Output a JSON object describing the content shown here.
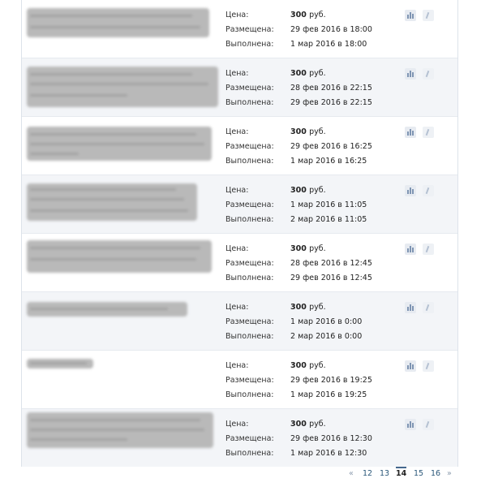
{
  "labels": {
    "price": "Цена:",
    "placed": "Размещена:",
    "completed": "Выполнена:"
  },
  "rows": [
    {
      "price_value": "300",
      "price_unit": "руб.",
      "placed": "29 фев 2016 в 18:00",
      "completed": "1 мар 2016 в 18:00"
    },
    {
      "price_value": "300",
      "price_unit": "руб.",
      "placed": "28 фев 2016 в 22:15",
      "completed": "29 фев 2016 в 22:15"
    },
    {
      "price_value": "300",
      "price_unit": "руб.",
      "placed": "29 фев 2016 в 16:25",
      "completed": "1 мар 2016 в 16:25"
    },
    {
      "price_value": "300",
      "price_unit": "руб.",
      "placed": "1 мар 2016 в 11:05",
      "completed": "2 мар 2016 в 11:05"
    },
    {
      "price_value": "300",
      "price_unit": "руб.",
      "placed": "28 фев 2016 в 12:45",
      "completed": "29 фев 2016 в 12:45"
    },
    {
      "price_value": "300",
      "price_unit": "руб.",
      "placed": "1 мар 2016 в 0:00",
      "completed": "2 мар 2016 в 0:00"
    },
    {
      "price_value": "300",
      "price_unit": "руб.",
      "placed": "29 фев 2016 в 19:25",
      "completed": "1 мар 2016 в 19:25"
    },
    {
      "price_value": "300",
      "price_unit": "руб.",
      "placed": "29 фев 2016 в 12:30",
      "completed": "1 мар 2016 в 12:30"
    }
  ],
  "icons": {
    "stats": "bar-chart-icon",
    "edit": "pencil-icon"
  },
  "pagination": {
    "prev": "«",
    "pages": [
      "12",
      "13",
      "14",
      "15",
      "16"
    ],
    "current": "14",
    "next": "»"
  },
  "colors": {
    "link": "#2b587a",
    "row_alt": "#f3f5f8",
    "accent": "#45688e"
  }
}
